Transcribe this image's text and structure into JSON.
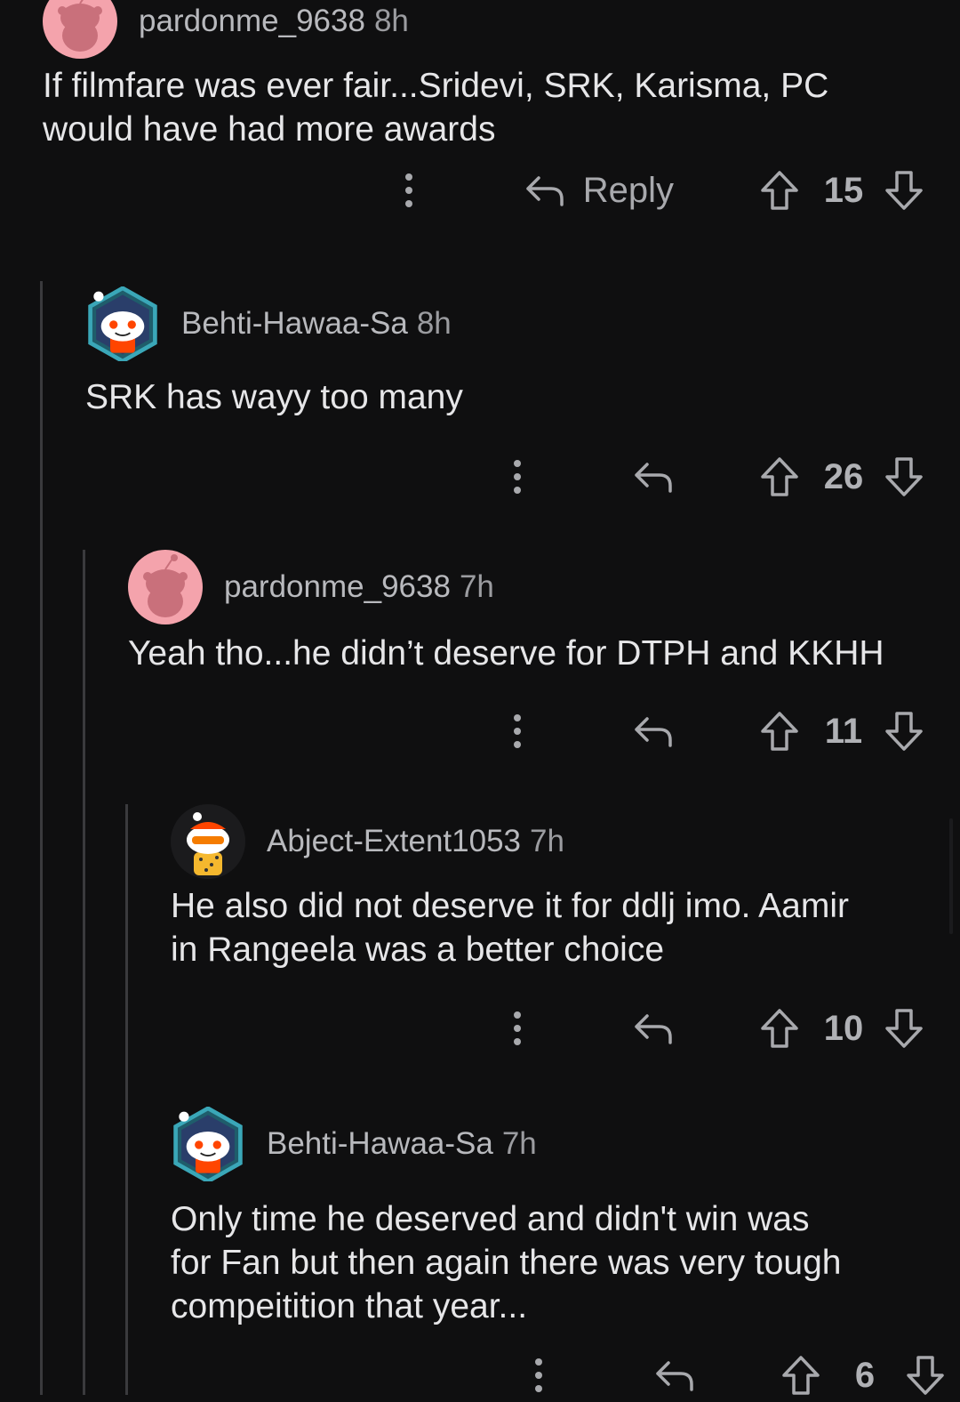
{
  "comments": [
    {
      "username": "pardonme_9638",
      "time": "8h",
      "text": "If filmfare was ever fair...Sridevi, SRK, Karisma, PC\nwould have had more awards",
      "reply_label": "Reply",
      "score": "15",
      "avatar": "pink-snoo-avatar"
    },
    {
      "username": "Behti-Hawaa-Sa",
      "time": "8h",
      "text": "SRK has wayy too many",
      "reply_label": "",
      "score": "26",
      "avatar": "hex-snoo-avatar"
    },
    {
      "username": "pardonme_9638",
      "time": "7h",
      "text": "Yeah tho...he didn’t deserve for DTPH and KKHH",
      "reply_label": "",
      "score": "11",
      "avatar": "pink-snoo-avatar"
    },
    {
      "username": "Abject-Extent1053",
      "time": "7h",
      "text": "He also did not deserve it for ddlj imo. Aamir\nin Rangeela was a better choice",
      "reply_label": "",
      "score": "10",
      "avatar": "sunglasses-snoo-avatar"
    },
    {
      "username": "Behti-Hawaa-Sa",
      "time": "7h",
      "text": "Only time he deserved and didn't win was\nfor Fan but then again there was very tough\ncompeitition that year...",
      "reply_label": "",
      "score": "6",
      "avatar": "hex-snoo-avatar"
    }
  ],
  "colors": {
    "background": "#0f0f10",
    "text": "#e6e6e8",
    "muted": "#a8a9ad",
    "thread_line": "#3a3a3d",
    "avatar_pink": "#f4a3ac",
    "hex_teal": "#3aa7b8",
    "snoo_orange": "#ff4500"
  }
}
